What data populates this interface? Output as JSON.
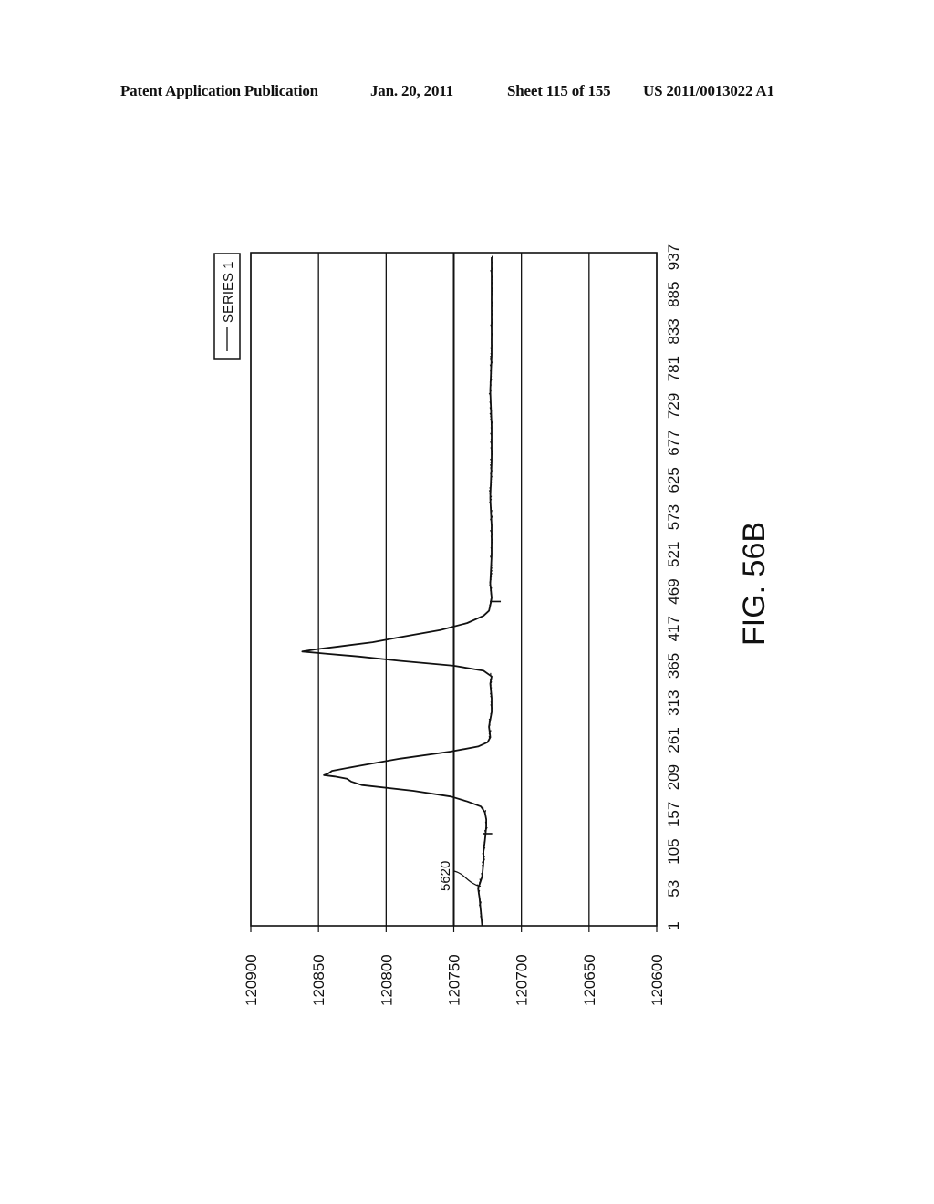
{
  "header": {
    "publication": "Patent Application Publication",
    "date": "Jan. 20, 2011",
    "sheet": "Sheet 115 of 155",
    "number": "US 2011/0013022 A1"
  },
  "figure_label": "FIG. 56B",
  "chart_data": {
    "type": "line",
    "orientation": "rotated-90-clockwise",
    "title": "",
    "xlabel": "",
    "ylabel": "",
    "x_ticks": [
      "1",
      "53",
      "105",
      "157",
      "209",
      "261",
      "313",
      "365",
      "417",
      "469",
      "521",
      "573",
      "625",
      "677",
      "729",
      "781",
      "833",
      "885",
      "937"
    ],
    "y_ticks": [
      "120900",
      "120850",
      "120800",
      "120750",
      "120700",
      "120650",
      "120600"
    ],
    "xlim": [
      1,
      937
    ],
    "ylim": [
      120600,
      120900
    ],
    "grid": "horizontal-major",
    "legend": {
      "entries": [
        "SERIES 1"
      ],
      "position": "top-right"
    },
    "annotations": [
      {
        "text": "5620",
        "x": 53,
        "y": 120735
      }
    ],
    "series": [
      {
        "name": "SERIES 1",
        "x": [
          1,
          20,
          40,
          53,
          70,
          90,
          105,
          120,
          140,
          150,
          160,
          168,
          175,
          182,
          190,
          198,
          203,
          207,
          210,
          212,
          214,
          218,
          225,
          235,
          245,
          252,
          258,
          265,
          280,
          300,
          320,
          340,
          350,
          358,
          365,
          372,
          378,
          382,
          385,
          388,
          392,
          398,
          405,
          415,
          425,
          435,
          442,
          450,
          460,
          480,
          520,
          560,
          600,
          650,
          700,
          750,
          800,
          850,
          900,
          937
        ],
        "y": [
          120729,
          120730,
          120731,
          120732,
          120729,
          120728,
          120728,
          120727,
          120726,
          120726,
          120727,
          120730,
          120740,
          120752,
          120780,
          120818,
          120826,
          120829,
          120838,
          120846,
          120843,
          120840,
          120820,
          120790,
          120752,
          120732,
          120725,
          120723,
          120724,
          120722,
          120722,
          120723,
          120722,
          120728,
          120750,
          120790,
          120820,
          120845,
          120862,
          120852,
          120835,
          120810,
          120790,
          120760,
          120740,
          120728,
          120724,
          120723,
          120722,
          120723,
          120722,
          120722,
          120723,
          120722,
          120722,
          120723,
          120722,
          120722,
          120722,
          120722
        ]
      }
    ]
  }
}
